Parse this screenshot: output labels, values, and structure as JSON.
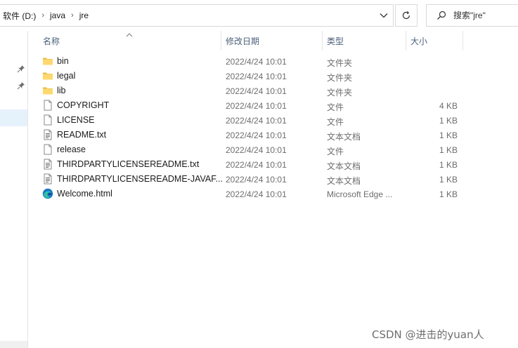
{
  "address": {
    "breadcrumbs": [
      "软件 (D:)",
      "java",
      "jre"
    ]
  },
  "search": {
    "placeholder": "搜索\"jre\""
  },
  "columns": {
    "name": "名称",
    "date": "修改日期",
    "type": "类型",
    "size": "大小"
  },
  "files": [
    {
      "name": "bin",
      "date": "2022/4/24 10:01",
      "type": "文件夹",
      "size": "",
      "icon": "folder-icon"
    },
    {
      "name": "legal",
      "date": "2022/4/24 10:01",
      "type": "文件夹",
      "size": "",
      "icon": "folder-icon"
    },
    {
      "name": "lib",
      "date": "2022/4/24 10:01",
      "type": "文件夹",
      "size": "",
      "icon": "folder-icon"
    },
    {
      "name": "COPYRIGHT",
      "date": "2022/4/24 10:01",
      "type": "文件",
      "size": "4 KB",
      "icon": "file-icon"
    },
    {
      "name": "LICENSE",
      "date": "2022/4/24 10:01",
      "type": "文件",
      "size": "1 KB",
      "icon": "file-icon"
    },
    {
      "name": "README.txt",
      "date": "2022/4/24 10:01",
      "type": "文本文档",
      "size": "1 KB",
      "icon": "text-file-icon"
    },
    {
      "name": "release",
      "date": "2022/4/24 10:01",
      "type": "文件",
      "size": "1 KB",
      "icon": "file-icon"
    },
    {
      "name": "THIRDPARTYLICENSEREADME.txt",
      "date": "2022/4/24 10:01",
      "type": "文本文档",
      "size": "1 KB",
      "icon": "text-file-icon"
    },
    {
      "name": "THIRDPARTYLICENSEREADME-JAVAF...",
      "date": "2022/4/24 10:01",
      "type": "文本文档",
      "size": "1 KB",
      "icon": "text-file-icon"
    },
    {
      "name": "Welcome.html",
      "date": "2022/4/24 10:01",
      "type": "Microsoft Edge ...",
      "size": "1 KB",
      "icon": "edge-icon"
    }
  ],
  "watermark": "CSDN @进击的yuan人",
  "colors": {
    "folder": "#ffd86e",
    "header_text": "#4c607a",
    "selection": "#e5f1fb",
    "edge_blue": "#1877c9",
    "edge_green": "#35c1a0"
  }
}
